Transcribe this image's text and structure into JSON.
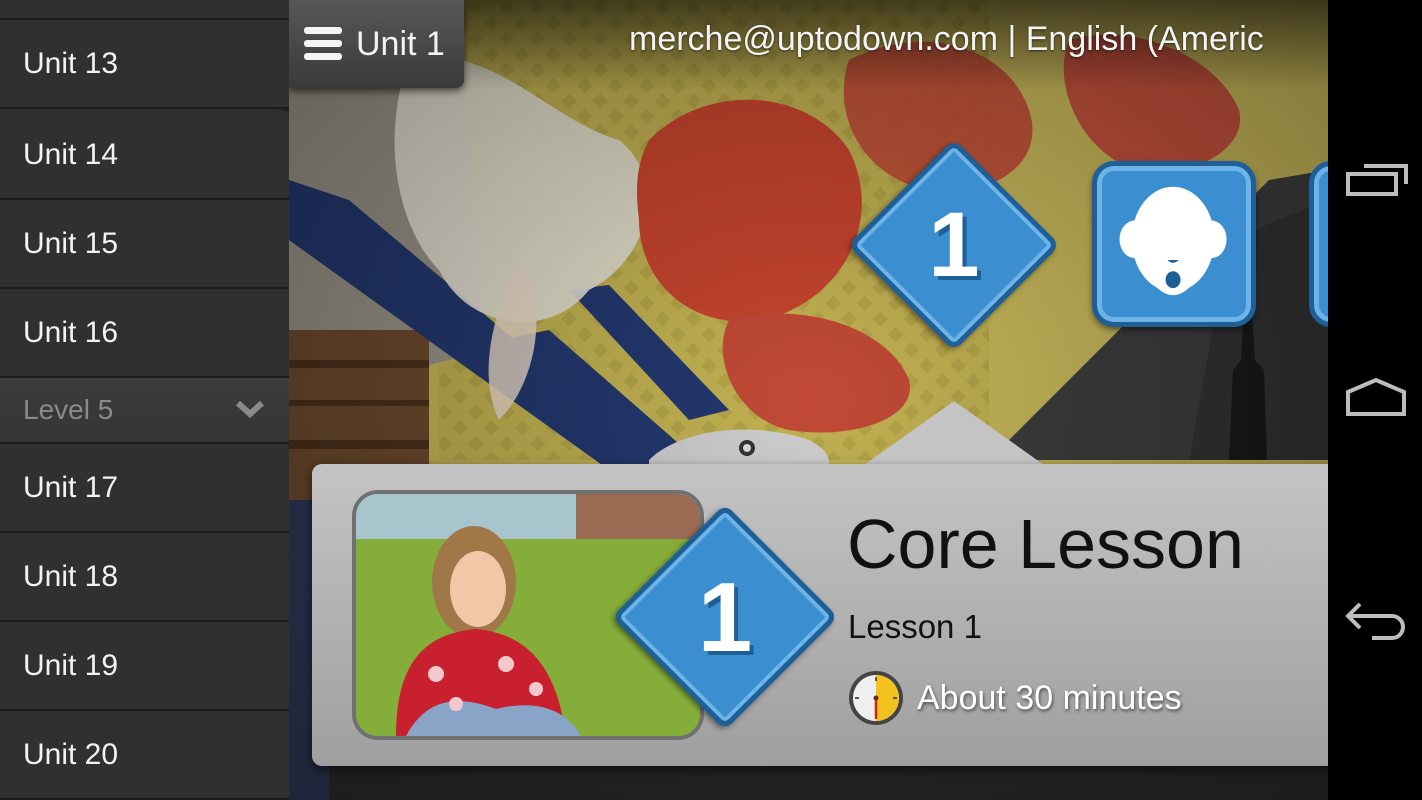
{
  "sidebar": {
    "items": [
      {
        "type": "unit",
        "label": "Unit 13"
      },
      {
        "type": "unit",
        "label": "Unit 14"
      },
      {
        "type": "unit",
        "label": "Unit 15"
      },
      {
        "type": "unit",
        "label": "Unit 16"
      },
      {
        "type": "level",
        "label": "Level 5",
        "icon": "chevron-down-icon"
      },
      {
        "type": "unit",
        "label": "Unit 17"
      },
      {
        "type": "unit",
        "label": "Unit 18"
      },
      {
        "type": "unit",
        "label": "Unit 19"
      },
      {
        "type": "unit",
        "label": "Unit 20"
      }
    ]
  },
  "header": {
    "unit_button_label": "Unit 1",
    "menu_icon": "hamburger-menu-icon",
    "account_text": "merche@uptodown.com | English (Americ"
  },
  "activities": {
    "current_number": "1",
    "speak_icon": "speaking-face-icon"
  },
  "lesson_card": {
    "badge_number": "1",
    "title": "Core Lesson",
    "subtitle": "Lesson 1",
    "duration": "About 30 minutes",
    "duration_icon": "clock-icon",
    "photo": "child-in-red-sweater-photo"
  },
  "navbar": {
    "buttons": [
      "recent-apps-icon",
      "home-icon",
      "back-icon"
    ]
  },
  "colors": {
    "badge_blue": "#3b8fd0",
    "badge_border": "#1d5f96",
    "sidebar_bg": "#303030",
    "card_bg": "#c4c4c4"
  }
}
